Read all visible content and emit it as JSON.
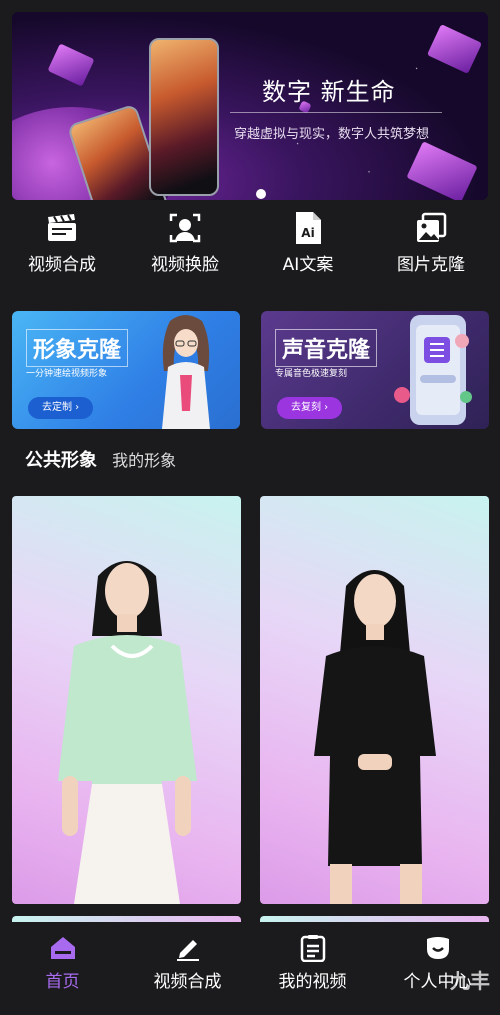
{
  "banner": {
    "title": "数字 新生命",
    "subtitle": "穿越虚拟与现实，数字人共筑梦想"
  },
  "quick_actions": [
    {
      "label": "视频合成",
      "icon": "clapperboard-icon"
    },
    {
      "label": "视频换脸",
      "icon": "face-scan-icon"
    },
    {
      "label": "AI文案",
      "icon": "ai-document-icon"
    },
    {
      "label": "图片克隆",
      "icon": "image-clone-icon"
    }
  ],
  "promo": [
    {
      "title": "形象克隆",
      "subtitle": "一分钟速绘视频形象",
      "button": "去定制 ›"
    },
    {
      "title": "声音克隆",
      "subtitle": "专属音色极速复刻",
      "button": "去复刻 ›"
    }
  ],
  "tabs": {
    "active": "公共形象",
    "other": "我的形象"
  },
  "bottom_nav": [
    {
      "label": "首页",
      "icon": "home-icon",
      "active": true
    },
    {
      "label": "视频合成",
      "icon": "pencil-icon",
      "active": false
    },
    {
      "label": "我的视频",
      "icon": "list-document-icon",
      "active": false
    },
    {
      "label": "个人中心",
      "icon": "profile-icon",
      "active": false
    }
  ],
  "watermark": "九丰",
  "colors": {
    "background": "#1b1b1d",
    "accent": "#a86bf0"
  }
}
